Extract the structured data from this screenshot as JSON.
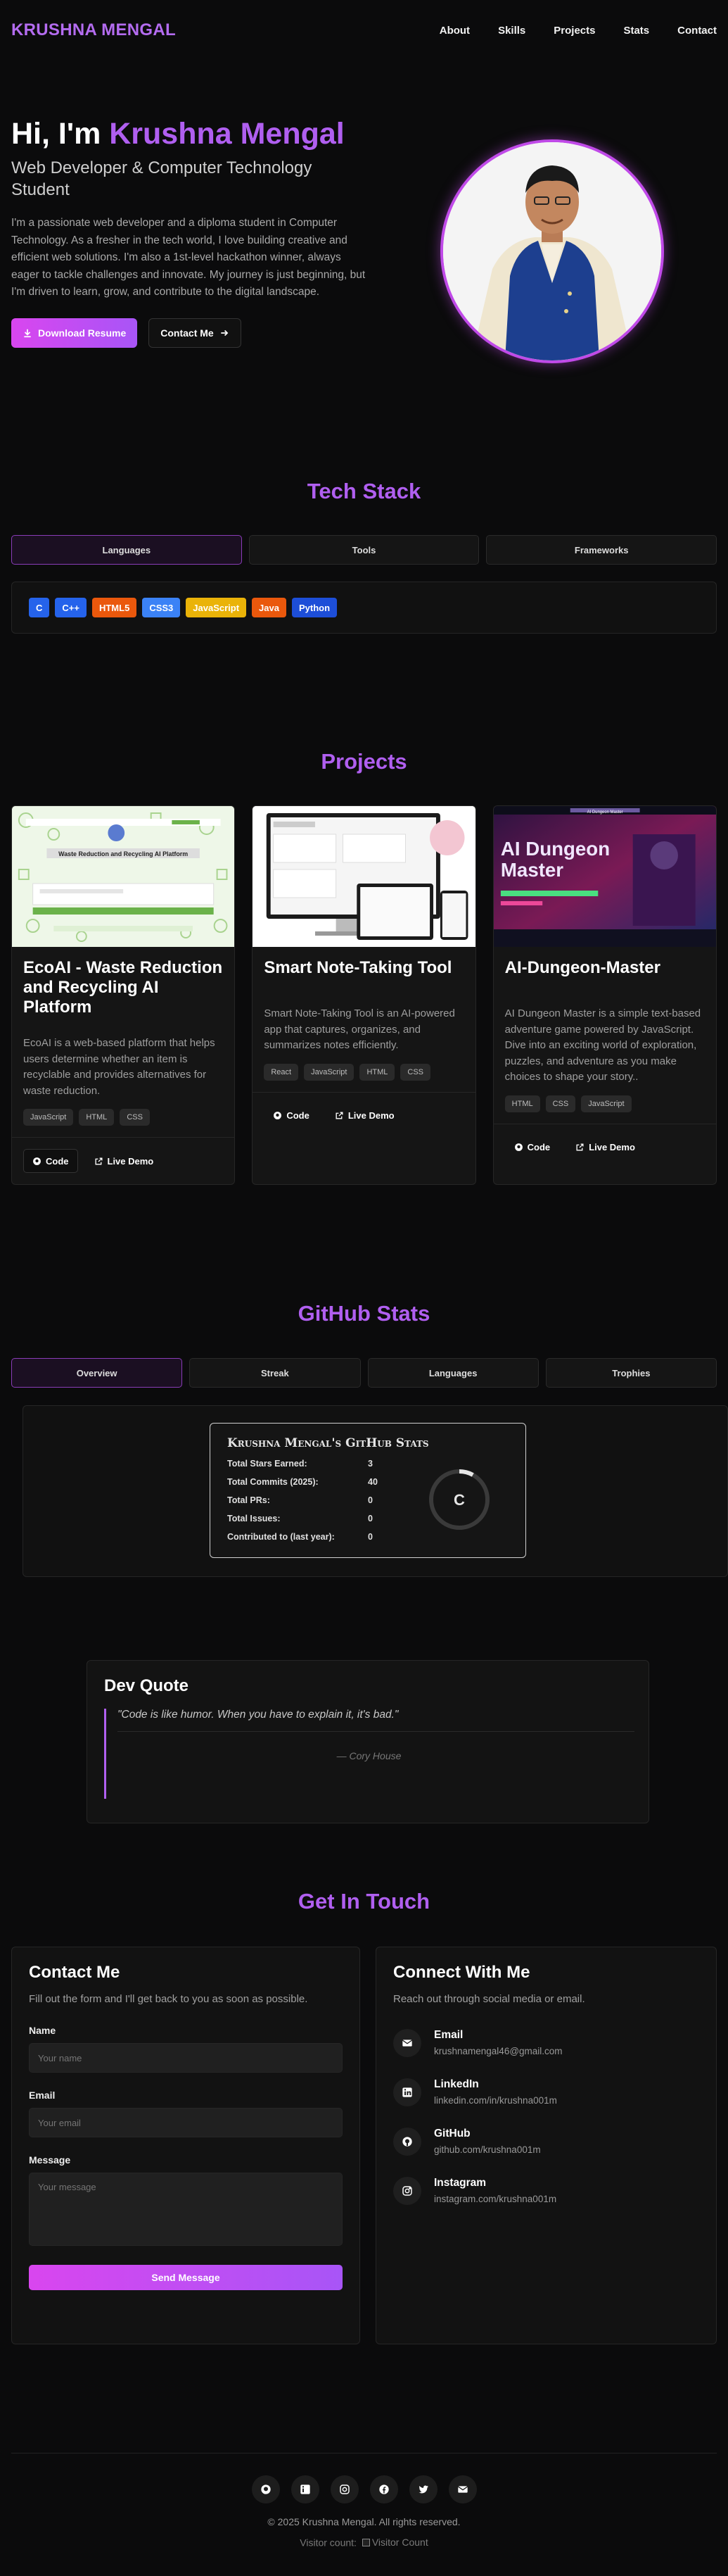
{
  "nav": {
    "brand": "KRUSHNA MENGAL",
    "links": [
      "About",
      "Skills",
      "Projects",
      "Stats",
      "Contact"
    ]
  },
  "hero": {
    "greeting": "Hi, I'm ",
    "name": "Krushna Mengal",
    "subtitle": "Web Developer & Computer Technology Student",
    "description": "I'm a passionate web developer and a diploma student in Computer Technology. As a fresher in the tech world, I love building creative and efficient web solutions. I'm also a 1st-level hackathon winner, always eager to tackle challenges and innovate. My journey is just beginning, but I'm driven to learn, grow, and contribute to the digital landscape.",
    "download_label": "Download Resume",
    "contact_label": "Contact Me"
  },
  "tech": {
    "title": "Tech Stack",
    "tabs": [
      "Languages",
      "Tools",
      "Frameworks"
    ],
    "chips": [
      {
        "label": "C",
        "color": "#2563eb"
      },
      {
        "label": "C++",
        "color": "#2563eb"
      },
      {
        "label": "HTML5",
        "color": "#ea580c"
      },
      {
        "label": "CSS3",
        "color": "#3b82f6"
      },
      {
        "label": "JavaScript",
        "color": "#eab308"
      },
      {
        "label": "Java",
        "color": "#ea580c"
      },
      {
        "label": "Python",
        "color": "#1d4ed8"
      }
    ]
  },
  "projects": {
    "title": "Projects",
    "items": [
      {
        "title": "EcoAI - Waste Reduction and Recycling AI Platform",
        "description": "EcoAI is a web-based platform that helps users determine whether an item is recyclable and provides alternatives for waste reduction.",
        "tags": [
          "JavaScript",
          "HTML",
          "CSS"
        ],
        "image_caption": "Waste Reduction and Recycling AI Platform"
      },
      {
        "title": "Smart Note-Taking Tool",
        "description": "Smart Note-Taking Tool is an AI-powered app that captures, organizes, and summarizes notes efficiently.",
        "tags": [
          "React",
          "JavaScript",
          "HTML",
          "CSS"
        ]
      },
      {
        "title": "AI-Dungeon-Master",
        "description": "AI Dungeon Master is a simple text-based adventure game powered by JavaScript. Dive into an exciting world of exploration, puzzles, and adventure as you make choices to shape your story..",
        "tags": [
          "HTML",
          "CSS",
          "JavaScript"
        ],
        "image_caption": "AI Dungeon Master"
      }
    ],
    "code_label": "Code",
    "demo_label": "Live Demo"
  },
  "github": {
    "title": "GitHub Stats",
    "tabs": [
      "Overview",
      "Streak",
      "Languages",
      "Trophies"
    ],
    "card_title": "Krushna Mengal's GitHub Stats",
    "rows": [
      {
        "k": "Total Stars Earned:",
        "v": "3"
      },
      {
        "k": "Total Commits (2025):",
        "v": "40"
      },
      {
        "k": "Total PRs:",
        "v": "0"
      },
      {
        "k": "Total Issues:",
        "v": "0"
      },
      {
        "k": "Contributed to (last year):",
        "v": "0"
      }
    ],
    "grade": "C",
    "grade_progress": 0.08
  },
  "quote": {
    "title": "Dev Quote",
    "text": "\"Code is like humor. When you have to explain it, it's bad.\"",
    "author": "— Cory House"
  },
  "contact": {
    "title": "Get In Touch",
    "form_title": "Contact Me",
    "form_desc": "Fill out the form and I'll get back to you as soon as possible.",
    "name_label": "Name",
    "name_placeholder": "Your name",
    "email_label": "Email",
    "email_placeholder": "Your email",
    "message_label": "Message",
    "message_placeholder": "Your message",
    "send_label": "Send Message",
    "connect_title": "Connect With Me",
    "connect_desc": "Reach out through social media or email.",
    "socials": [
      {
        "name": "Email",
        "value": "krushnamengal46@gmail.com",
        "icon": "mail-icon"
      },
      {
        "name": "LinkedIn",
        "value": "linkedin.com/in/krushna001m",
        "icon": "linkedin-icon"
      },
      {
        "name": "GitHub",
        "value": "github.com/krushna001m",
        "icon": "github-icon"
      },
      {
        "name": "Instagram",
        "value": "instagram.com/krushna001m",
        "icon": "instagram-icon"
      }
    ]
  },
  "footer": {
    "copyright": "© 2025 Krushna Mengal. All rights reserved.",
    "visitor_label": "Visitor count:",
    "visitor_img_alt": "Visitor Count"
  }
}
